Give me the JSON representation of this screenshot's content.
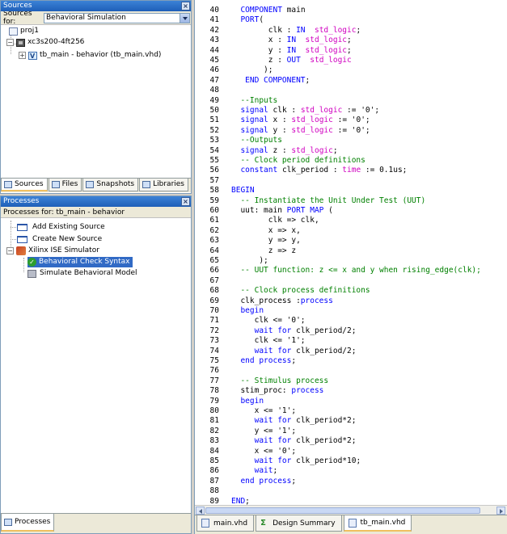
{
  "sources_panel": {
    "title": "Sources",
    "sources_for_label": "Sources for:",
    "sources_for_value": "Behavioral Simulation",
    "tree": [
      {
        "label": "proj1"
      },
      {
        "label": "xc3s200-4ft256"
      },
      {
        "label": "tb_main - behavior (tb_main.vhd)"
      }
    ],
    "tabs": [
      "Sources",
      "Files",
      "Snapshots",
      "Libraries"
    ]
  },
  "processes_panel": {
    "title": "Processes",
    "processes_for": "Processes for: tb_main - behavior",
    "tree": [
      {
        "label": "Add Existing Source"
      },
      {
        "label": "Create New Source"
      },
      {
        "label": "Xilinx ISE Simulator"
      },
      {
        "label": "Behavioral Check Syntax"
      },
      {
        "label": "Simulate Behavioral Model"
      }
    ],
    "tab": "Processes"
  },
  "editor": {
    "lines": [
      {
        "n": "40",
        "segs": [
          [
            "tx",
            "  "
          ],
          [
            "kw",
            "COMPONENT"
          ],
          [
            "tx",
            " main"
          ]
        ]
      },
      {
        "n": "41",
        "segs": [
          [
            "tx",
            "  "
          ],
          [
            "kw",
            "PORT"
          ],
          [
            "tx",
            "("
          ]
        ]
      },
      {
        "n": "42",
        "segs": [
          [
            "tx",
            "        clk : "
          ],
          [
            "kw",
            "IN"
          ],
          [
            "tx",
            "  "
          ],
          [
            "ty",
            "std_logic"
          ],
          [
            "tx",
            ";"
          ]
        ]
      },
      {
        "n": "43",
        "segs": [
          [
            "tx",
            "        x : "
          ],
          [
            "kw",
            "IN"
          ],
          [
            "tx",
            "  "
          ],
          [
            "ty",
            "std_logic"
          ],
          [
            "tx",
            ";"
          ]
        ]
      },
      {
        "n": "44",
        "segs": [
          [
            "tx",
            "        y : "
          ],
          [
            "kw",
            "IN"
          ],
          [
            "tx",
            "  "
          ],
          [
            "ty",
            "std_logic"
          ],
          [
            "tx",
            ";"
          ]
        ]
      },
      {
        "n": "45",
        "segs": [
          [
            "tx",
            "        z : "
          ],
          [
            "kw",
            "OUT"
          ],
          [
            "tx",
            "  "
          ],
          [
            "ty",
            "std_logic"
          ]
        ]
      },
      {
        "n": "46",
        "segs": [
          [
            "tx",
            "       );"
          ]
        ]
      },
      {
        "n": "47",
        "segs": [
          [
            "tx",
            "   "
          ],
          [
            "kw",
            "END COMPONENT"
          ],
          [
            "tx",
            ";"
          ]
        ]
      },
      {
        "n": "48",
        "segs": [
          [
            "tx",
            ""
          ]
        ]
      },
      {
        "n": "49",
        "segs": [
          [
            "cm",
            "  --Inputs"
          ]
        ]
      },
      {
        "n": "50",
        "segs": [
          [
            "tx",
            "  "
          ],
          [
            "kw",
            "signal"
          ],
          [
            "tx",
            " clk : "
          ],
          [
            "ty",
            "std_logic"
          ],
          [
            "tx",
            " := '0';"
          ]
        ]
      },
      {
        "n": "51",
        "segs": [
          [
            "tx",
            "  "
          ],
          [
            "kw",
            "signal"
          ],
          [
            "tx",
            " x : "
          ],
          [
            "ty",
            "std_logic"
          ],
          [
            "tx",
            " := '0';"
          ]
        ]
      },
      {
        "n": "52",
        "segs": [
          [
            "tx",
            "  "
          ],
          [
            "kw",
            "signal"
          ],
          [
            "tx",
            " y : "
          ],
          [
            "ty",
            "std_logic"
          ],
          [
            "tx",
            " := '0';"
          ]
        ]
      },
      {
        "n": "53",
        "segs": [
          [
            "cm",
            "  --Outputs"
          ]
        ]
      },
      {
        "n": "54",
        "segs": [
          [
            "tx",
            "  "
          ],
          [
            "kw",
            "signal"
          ],
          [
            "tx",
            " z : "
          ],
          [
            "ty",
            "std_logic"
          ],
          [
            "tx",
            ";"
          ]
        ]
      },
      {
        "n": "55",
        "segs": [
          [
            "cm",
            "  -- Clock period definitions"
          ]
        ]
      },
      {
        "n": "56",
        "segs": [
          [
            "tx",
            "  "
          ],
          [
            "kw",
            "constant"
          ],
          [
            "tx",
            " clk_period : "
          ],
          [
            "ty",
            "time"
          ],
          [
            "tx",
            " := 0.1us;"
          ]
        ]
      },
      {
        "n": "57",
        "segs": [
          [
            "tx",
            ""
          ]
        ]
      },
      {
        "n": "58",
        "segs": [
          [
            "kw",
            "BEGIN"
          ]
        ]
      },
      {
        "n": "59",
        "segs": [
          [
            "cm",
            "  -- Instantiate the Unit Under Test (UUT)"
          ]
        ]
      },
      {
        "n": "60",
        "segs": [
          [
            "tx",
            "  uut: main "
          ],
          [
            "kw",
            "PORT MAP"
          ],
          [
            "tx",
            " ("
          ]
        ]
      },
      {
        "n": "61",
        "segs": [
          [
            "tx",
            "        clk => clk,"
          ]
        ]
      },
      {
        "n": "62",
        "segs": [
          [
            "tx",
            "        x => x,"
          ]
        ]
      },
      {
        "n": "63",
        "segs": [
          [
            "tx",
            "        y => y,"
          ]
        ]
      },
      {
        "n": "64",
        "segs": [
          [
            "tx",
            "        z => z"
          ]
        ]
      },
      {
        "n": "65",
        "segs": [
          [
            "tx",
            "      );"
          ]
        ]
      },
      {
        "n": "66",
        "segs": [
          [
            "cm",
            "  -- UUT function: z <= x and y when rising_edge(clk);"
          ]
        ]
      },
      {
        "n": "67",
        "segs": [
          [
            "tx",
            ""
          ]
        ]
      },
      {
        "n": "68",
        "segs": [
          [
            "cm",
            "  -- Clock process definitions"
          ]
        ]
      },
      {
        "n": "69",
        "segs": [
          [
            "tx",
            "  clk_process :"
          ],
          [
            "kw",
            "process"
          ]
        ]
      },
      {
        "n": "70",
        "segs": [
          [
            "tx",
            "  "
          ],
          [
            "kw",
            "begin"
          ]
        ]
      },
      {
        "n": "71",
        "segs": [
          [
            "tx",
            "     clk <= '0';"
          ]
        ]
      },
      {
        "n": "72",
        "segs": [
          [
            "tx",
            "     "
          ],
          [
            "kw",
            "wait for"
          ],
          [
            "tx",
            " clk_period/2;"
          ]
        ]
      },
      {
        "n": "73",
        "segs": [
          [
            "tx",
            "     clk <= '1';"
          ]
        ]
      },
      {
        "n": "74",
        "segs": [
          [
            "tx",
            "     "
          ],
          [
            "kw",
            "wait for"
          ],
          [
            "tx",
            " clk_period/2;"
          ]
        ]
      },
      {
        "n": "75",
        "segs": [
          [
            "tx",
            "  "
          ],
          [
            "kw",
            "end process"
          ],
          [
            "tx",
            ";"
          ]
        ]
      },
      {
        "n": "76",
        "segs": [
          [
            "tx",
            ""
          ]
        ]
      },
      {
        "n": "77",
        "segs": [
          [
            "cm",
            "  -- Stimulus process"
          ]
        ]
      },
      {
        "n": "78",
        "segs": [
          [
            "tx",
            "  stim_proc: "
          ],
          [
            "kw",
            "process"
          ]
        ]
      },
      {
        "n": "79",
        "segs": [
          [
            "tx",
            "  "
          ],
          [
            "kw",
            "begin"
          ]
        ]
      },
      {
        "n": "80",
        "segs": [
          [
            "tx",
            "     x <= '1';"
          ]
        ]
      },
      {
        "n": "81",
        "segs": [
          [
            "tx",
            "     "
          ],
          [
            "kw",
            "wait for"
          ],
          [
            "tx",
            " clk_period*2;"
          ]
        ]
      },
      {
        "n": "82",
        "segs": [
          [
            "tx",
            "     y <= '1';"
          ]
        ]
      },
      {
        "n": "83",
        "segs": [
          [
            "tx",
            "     "
          ],
          [
            "kw",
            "wait for"
          ],
          [
            "tx",
            " clk_period*2;"
          ]
        ]
      },
      {
        "n": "84",
        "segs": [
          [
            "tx",
            "     x <= '0';"
          ]
        ]
      },
      {
        "n": "85",
        "segs": [
          [
            "tx",
            "     "
          ],
          [
            "kw",
            "wait for"
          ],
          [
            "tx",
            " clk_period*10;"
          ]
        ]
      },
      {
        "n": "86",
        "segs": [
          [
            "tx",
            "     "
          ],
          [
            "kw",
            "wait"
          ],
          [
            "tx",
            ";"
          ]
        ]
      },
      {
        "n": "87",
        "segs": [
          [
            "tx",
            "  "
          ],
          [
            "kw",
            "end process"
          ],
          [
            "tx",
            ";"
          ]
        ]
      },
      {
        "n": "88",
        "segs": [
          [
            "tx",
            ""
          ]
        ]
      },
      {
        "n": "89",
        "segs": [
          [
            "kw",
            "END"
          ],
          [
            "tx",
            ";"
          ]
        ]
      }
    ],
    "doc_tabs": [
      "main.vhd",
      "Design Summary",
      "tb_main.vhd"
    ],
    "active_tab": "tb_main.vhd"
  },
  "colors": {
    "keyword": "#0000ff",
    "type": "#d000c0",
    "comment": "#008000",
    "selection": "#316ac5",
    "title_bar": "#2a6cc8"
  }
}
